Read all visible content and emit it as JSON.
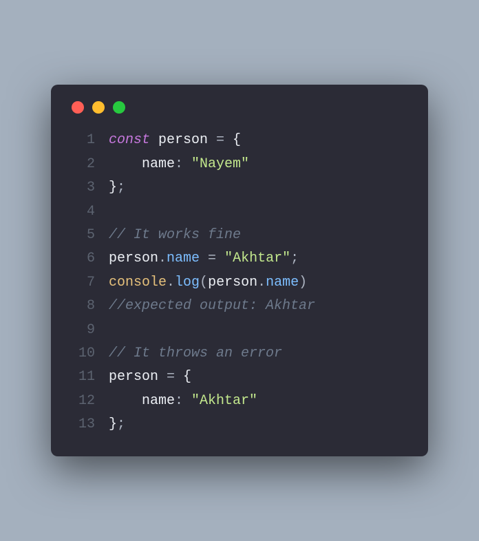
{
  "window": {
    "traffic": [
      "red",
      "yellow",
      "green"
    ]
  },
  "code": {
    "lines": [
      {
        "num": "1",
        "tokens": [
          {
            "cls": "c-keyword",
            "t": "const"
          },
          {
            "cls": "c-default",
            "t": " person "
          },
          {
            "cls": "c-punc",
            "t": "= "
          },
          {
            "cls": "c-default",
            "t": "{"
          }
        ]
      },
      {
        "num": "2",
        "tokens": [
          {
            "cls": "c-default",
            "t": "    "
          },
          {
            "cls": "c-prop",
            "t": "name"
          },
          {
            "cls": "c-punc",
            "t": ": "
          },
          {
            "cls": "c-string",
            "t": "\"Nayem\""
          }
        ]
      },
      {
        "num": "3",
        "tokens": [
          {
            "cls": "c-default",
            "t": "}"
          },
          {
            "cls": "c-punc",
            "t": ";"
          }
        ]
      },
      {
        "num": "4",
        "tokens": [
          {
            "cls": "c-default",
            "t": " "
          }
        ]
      },
      {
        "num": "5",
        "tokens": [
          {
            "cls": "c-comment",
            "t": "// It works fine"
          }
        ]
      },
      {
        "num": "6",
        "tokens": [
          {
            "cls": "c-default",
            "t": "person"
          },
          {
            "cls": "c-punc",
            "t": "."
          },
          {
            "cls": "c-attr",
            "t": "name"
          },
          {
            "cls": "c-punc",
            "t": " = "
          },
          {
            "cls": "c-string",
            "t": "\"Akhtar\""
          },
          {
            "cls": "c-punc",
            "t": ";"
          }
        ]
      },
      {
        "num": "7",
        "tokens": [
          {
            "cls": "c-builtin",
            "t": "console"
          },
          {
            "cls": "c-punc",
            "t": "."
          },
          {
            "cls": "c-func",
            "t": "log"
          },
          {
            "cls": "c-punc",
            "t": "("
          },
          {
            "cls": "c-default",
            "t": "person"
          },
          {
            "cls": "c-punc",
            "t": "."
          },
          {
            "cls": "c-attr",
            "t": "name"
          },
          {
            "cls": "c-punc",
            "t": ")"
          }
        ]
      },
      {
        "num": "8",
        "tokens": [
          {
            "cls": "c-comment",
            "t": "//expected output: Akhtar"
          }
        ]
      },
      {
        "num": "9",
        "tokens": [
          {
            "cls": "c-default",
            "t": " "
          }
        ]
      },
      {
        "num": "10",
        "tokens": [
          {
            "cls": "c-comment",
            "t": "// It throws an error"
          }
        ]
      },
      {
        "num": "11",
        "tokens": [
          {
            "cls": "c-default",
            "t": "person "
          },
          {
            "cls": "c-punc",
            "t": "= "
          },
          {
            "cls": "c-default",
            "t": "{"
          }
        ]
      },
      {
        "num": "12",
        "tokens": [
          {
            "cls": "c-default",
            "t": "    "
          },
          {
            "cls": "c-prop",
            "t": "name"
          },
          {
            "cls": "c-punc",
            "t": ": "
          },
          {
            "cls": "c-string",
            "t": "\"Akhtar\""
          }
        ]
      },
      {
        "num": "13",
        "tokens": [
          {
            "cls": "c-default",
            "t": "}"
          },
          {
            "cls": "c-punc",
            "t": ";"
          }
        ]
      }
    ]
  }
}
